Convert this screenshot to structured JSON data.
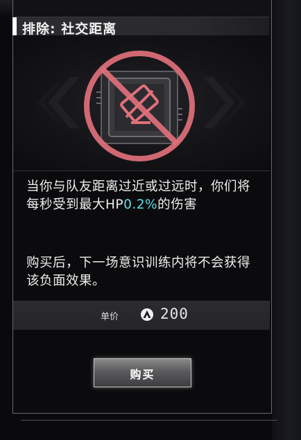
{
  "card": {
    "title": "排除: 社交距离",
    "icon": "no-social-distance-icon",
    "description_main_before": "当你与队友距离过近或过远时，你们将每秒受到最大HP",
    "description_main_highlight": "0.2%",
    "description_main_after": "的伤害",
    "description_secondary": "购买后，下一场意识训练内将不会获得该负面效果。",
    "price_label": "单价",
    "currency_icon": "currency-a-icon",
    "price_value": "200",
    "buy_label": "购买"
  },
  "colors": {
    "highlight": "#5ce0e8",
    "prohibition_red": "#e0707a",
    "panel_bg": "#0b0b0d"
  }
}
